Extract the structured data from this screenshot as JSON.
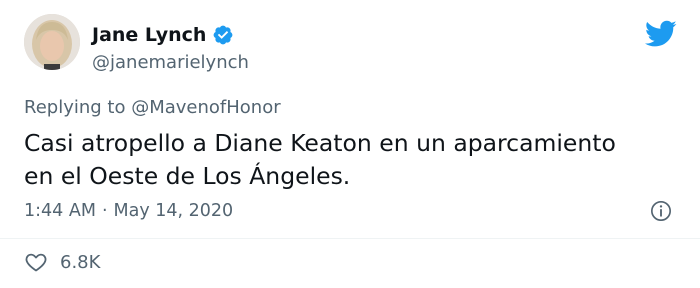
{
  "user": {
    "display_name": "Jane Lynch",
    "handle": "@janemarielynch"
  },
  "tweet": {
    "reply_prefix": "Replying to",
    "reply_to": "@MavenofHonor",
    "text": "Casi atropello a Diane Keaton en un aparcamiento\nen el Oeste de Los Ángeles.",
    "time": "1:44 AM",
    "separator": "·",
    "date": "May 14, 2020",
    "likes": "6.8K"
  },
  "icons": {
    "verified": "verified-badge-icon",
    "brand": "twitter-bird-icon",
    "info": "info-icon",
    "like": "heart-icon"
  },
  "colors": {
    "brand_blue": "#1d9bf0",
    "text_primary": "#0f1419",
    "text_secondary": "#536471"
  }
}
